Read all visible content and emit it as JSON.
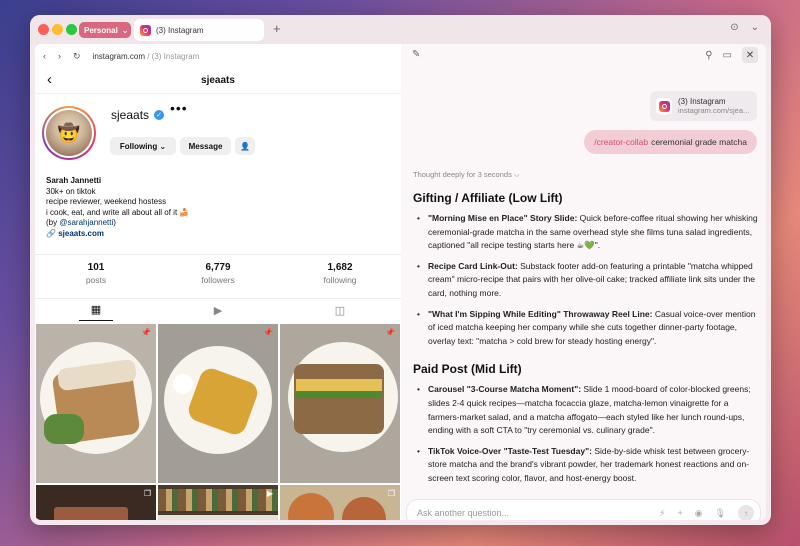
{
  "browser": {
    "profile_label": "Personal",
    "tab_title": "(3) Instagram",
    "url_main": "instagram.com",
    "url_suffix": " / (3) Instagram"
  },
  "profile": {
    "header_handle": "sjeaats",
    "handle": "sjeaats",
    "following_btn": "Following",
    "message_btn": "Message",
    "bio": {
      "name": "Sarah Jannetti",
      "line1": "30k+ on tiktok",
      "line2": "recipe reviewer, weekend hostess",
      "line3": "i cook, eat, and write all about all of it 🍰",
      "by_prefix": "(by ",
      "mention": "@sarahjannetti",
      "by_suffix": ")",
      "link": "sjeaats.com"
    },
    "stats": [
      {
        "num": "101",
        "label": "posts"
      },
      {
        "num": "6,779",
        "label": "followers"
      },
      {
        "num": "1,682",
        "label": "following"
      }
    ]
  },
  "assistant": {
    "ctx_title": "(3) Instagram",
    "ctx_url": "instagram.com/sjea...",
    "user_cmd": "/creator-collab",
    "user_text": "ceremonial grade matcha",
    "thought": "Thought deeply for 3 seconds ⌵",
    "section1": "Gifting / Affiliate (Low Lift)",
    "s1_items": [
      {
        "bold": "\"Morning Mise en Place\" Story Slide:",
        "text": " Quick before-coffee ritual showing her whisking ceremonial-grade matcha in the same overhead style she films tuna salad ingredients, captioned \"all recipe testing starts here ☕💚\"."
      },
      {
        "bold": "Recipe Card Link-Out:",
        "text": " Substack footer add-on featuring a printable \"matcha whipped cream\" micro-recipe that pairs with her olive-oil cake; tracked affiliate link sits under the card, nothing more."
      },
      {
        "bold": "\"What I'm Sipping While Editing\" Throwaway Reel Line:",
        "text": " Casual voice-over mention of iced matcha keeping her company while she cuts together dinner-party footage, overlay text: \"matcha > cold brew for steady hosting energy\"."
      }
    ],
    "section2": "Paid Post (Mid Lift)",
    "s2_items": [
      {
        "bold": "Carousel \"3-Course Matcha Moment\":",
        "text": " Slide 1 mood-board of color-blocked greens; slides 2-4 quick recipes—matcha focaccia glaze, matcha-lemon vinaigrette for a farmers-market salad, and a matcha affogato—each styled like her lunch round-ups, ending with a soft CTA to \"try ceremonial vs. culinary grade\"."
      },
      {
        "bold": "TikTok Voice-Over \"Taste-Test Tuesday\":",
        "text": " Side-by-side whisk test between grocery-store matcha and the brand's vibrant powder, her trademark honest reactions and on-screen text scoring color, flavor, and host-energy boost."
      }
    ],
    "composer_placeholder": "Ask another question..."
  }
}
